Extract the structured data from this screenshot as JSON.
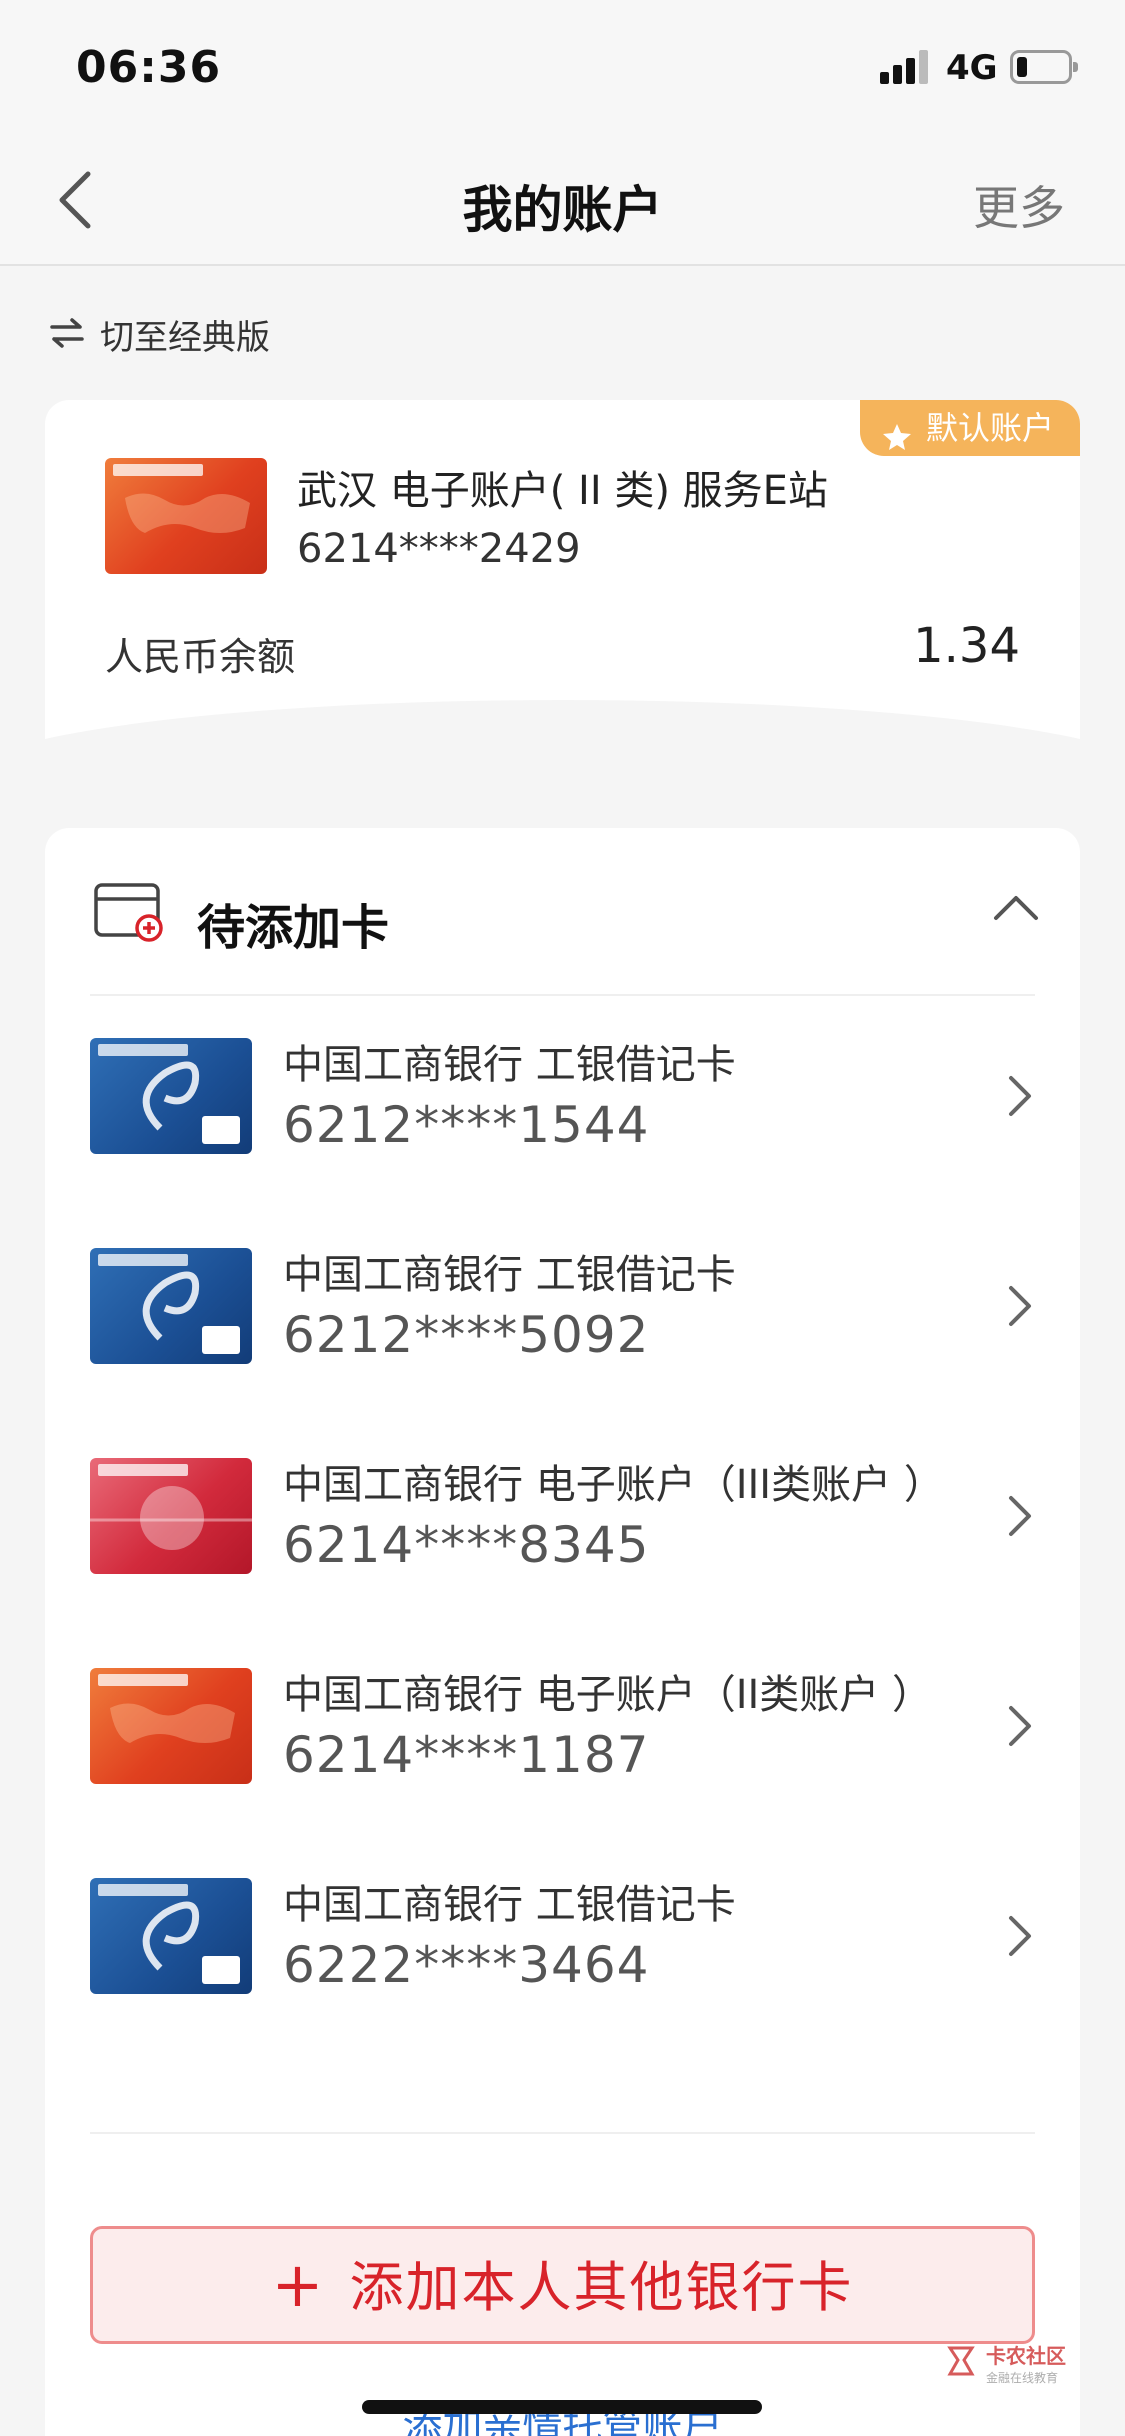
{
  "status": {
    "time": "06:36",
    "network": "4G"
  },
  "nav": {
    "title": "我的账户",
    "more": "更多"
  },
  "switch": {
    "label": "切至经典版"
  },
  "default_account": {
    "badge": "默认账户",
    "name": "武汉 电子账户( II 类) 服务E站",
    "number": "6214****2429",
    "balance_label": "人民币余额",
    "balance": "1.34"
  },
  "pending": {
    "title": "待添加卡",
    "cards": [
      {
        "name": "中国工商银行 工银借记卡",
        "number": "6212****1544",
        "style": "blue"
      },
      {
        "name": "中国工商银行 工银借记卡",
        "number": "6212****5092",
        "style": "blue"
      },
      {
        "name": "中国工商银行 电子账户（III类账户 ）",
        "number": "6214****8345",
        "style": "red"
      },
      {
        "name": "中国工商银行 电子账户（II类账户 ）",
        "number": "6214****1187",
        "style": "orange"
      },
      {
        "name": "中国工商银行 工银借记卡",
        "number": "6222****3464",
        "style": "blue"
      }
    ]
  },
  "actions": {
    "add_plus": "+",
    "add_card": "添加本人其他银行卡",
    "add_family": "添加亲情托管账户"
  },
  "watermark": {
    "text": "卡农社区",
    "sub": "金融在线教育"
  },
  "colors": {
    "accent_red": "#d8232a",
    "badge_orange": "#f5b45b",
    "link_blue": "#2a6fd1"
  }
}
